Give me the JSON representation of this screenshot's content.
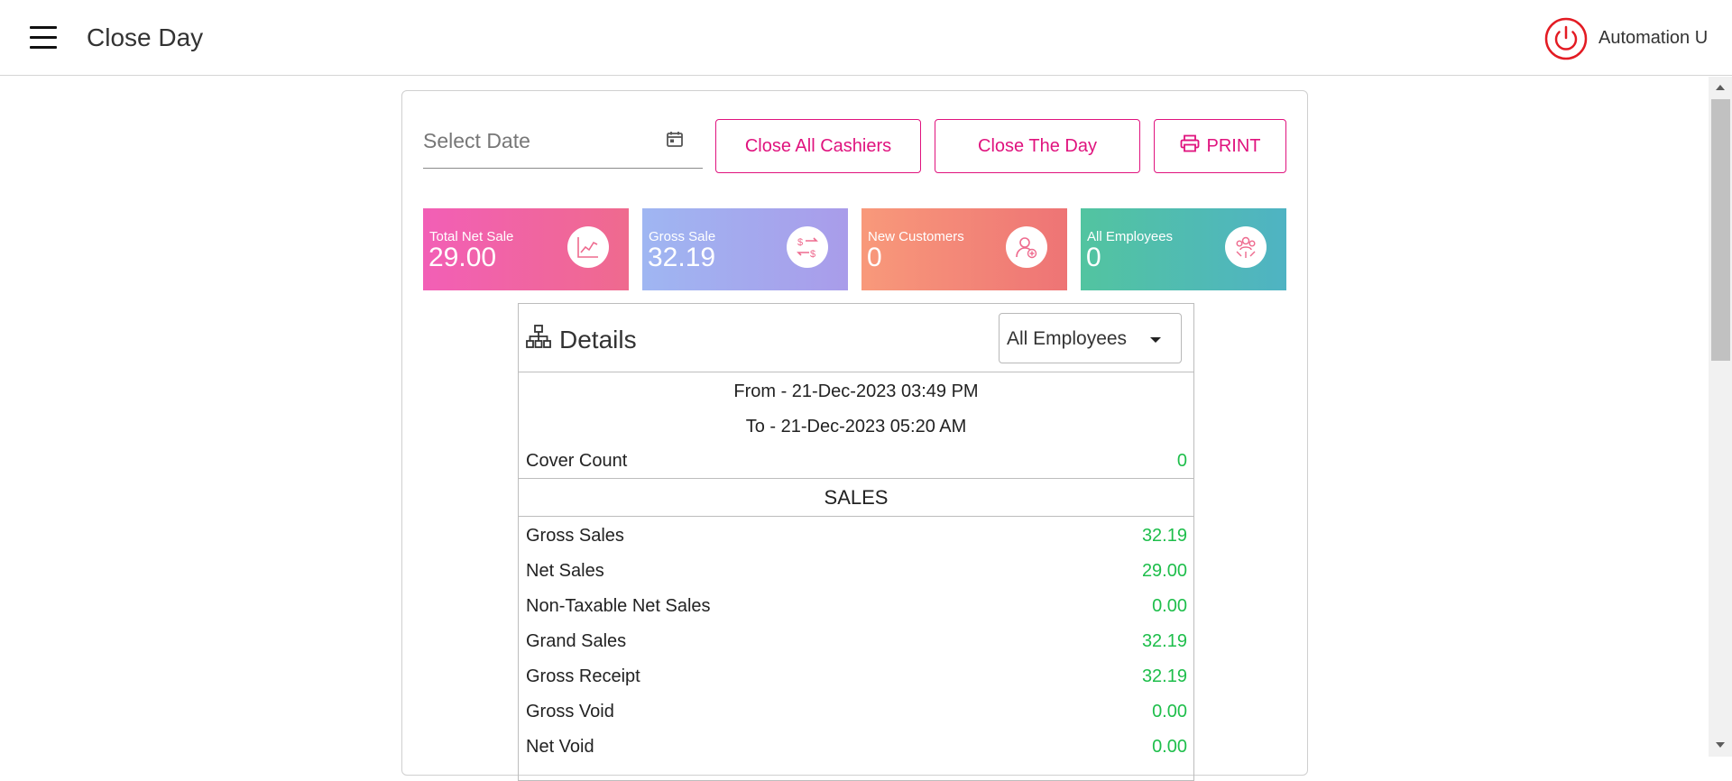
{
  "header": {
    "title": "Close Day",
    "user_name": "Automation U",
    "power_color": "#e31b23"
  },
  "toolbar": {
    "date_placeholder": "Select Date",
    "close_all_cashiers": "Close All Cashiers",
    "close_the_day": "Close The Day",
    "print": "PRINT",
    "accent": "#e0137e"
  },
  "tiles": [
    {
      "label": "Total Net Sale",
      "value": "29.00",
      "icon": "chart-line-icon"
    },
    {
      "label": "Gross Sale",
      "value": "32.19",
      "icon": "exchange-dollar-icon"
    },
    {
      "label": "New Customers",
      "value": "0",
      "icon": "user-add-icon"
    },
    {
      "label": "All Employees",
      "value": "0",
      "icon": "team-icon"
    }
  ],
  "details": {
    "title": "Details",
    "employee_filter": "All Employees",
    "from": "From - 21-Dec-2023 03:49 PM",
    "to": "To - 21-Dec-2023 05:20 AM",
    "cover_count_label": "Cover Count",
    "cover_count_value": "0",
    "sales_heading": "SALES",
    "value_color": "#1ebe4b",
    "rows": [
      {
        "label": "Gross Sales",
        "value": "32.19"
      },
      {
        "label": "Net Sales",
        "value": "29.00"
      },
      {
        "label": "Non-Taxable Net Sales",
        "value": "0.00"
      },
      {
        "label": "Grand Sales",
        "value": "32.19"
      },
      {
        "label": "Gross Receipt",
        "value": "32.19"
      },
      {
        "label": "Gross Void",
        "value": "0.00"
      },
      {
        "label": "Net Void",
        "value": "0.00"
      }
    ]
  }
}
